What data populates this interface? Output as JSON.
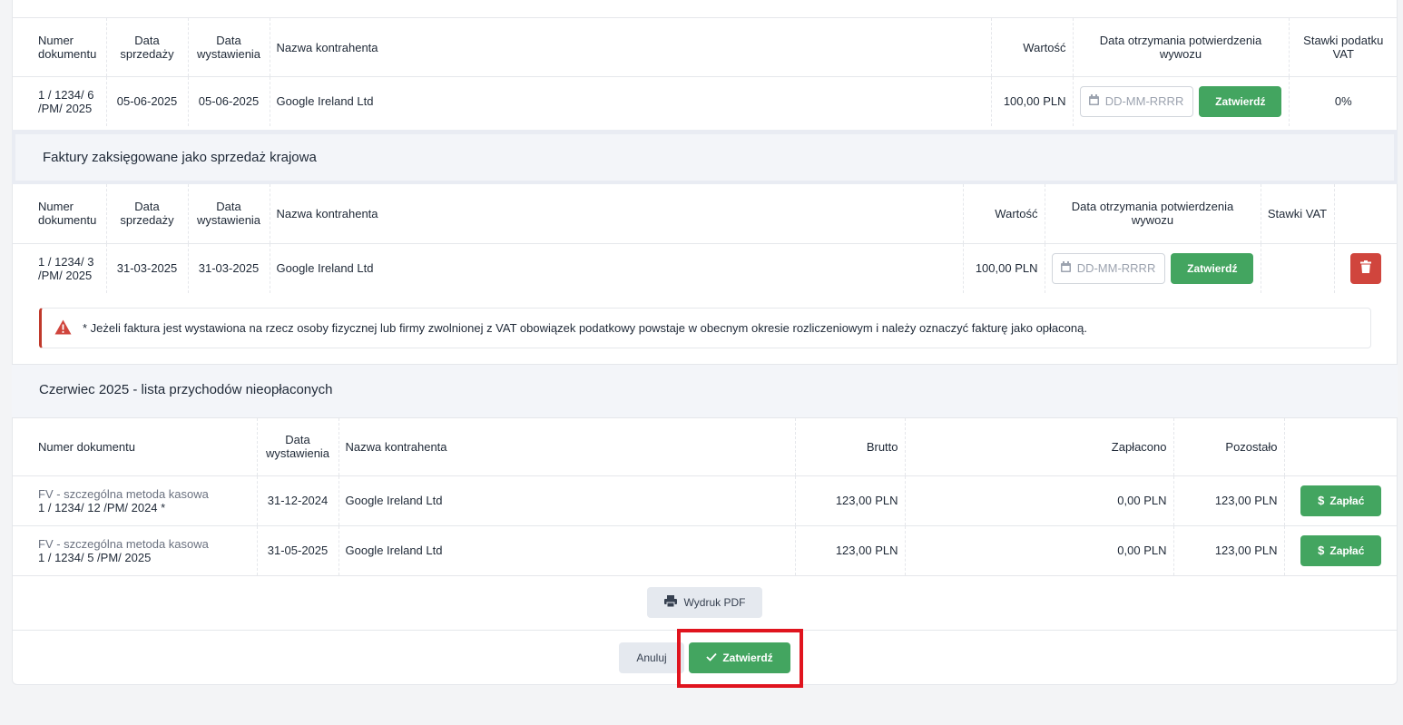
{
  "table1": {
    "headers": [
      "Numer dokumentu",
      "Data sprzedaży",
      "Data wystawienia",
      "Nazwa kontrahenta",
      "Wartość",
      "Data otrzymania potwierdzenia wywozu",
      "Stawki podatku VAT"
    ],
    "row": {
      "number": "1 / 1234/ 6 /PM/ 2025",
      "sale_date": "05-06-2025",
      "issue_date": "05-06-2025",
      "contractor": "Google Ireland Ltd",
      "value": "100,00 PLN",
      "date_placeholder": "DD-MM-RRRR",
      "confirm_label": "Zatwierdź",
      "vat": "0%"
    }
  },
  "section_domestic": {
    "title": "Faktury zaksięgowane jako sprzedaż krajowa"
  },
  "table2": {
    "headers": [
      "Numer dokumentu",
      "Data sprzedaży",
      "Data wystawienia",
      "Nazwa kontrahenta",
      "Wartość",
      "Data otrzymania potwierdzenia wywozu",
      "Stawki VAT"
    ],
    "row": {
      "number": "1 / 1234/ 3 /PM/ 2025",
      "sale_date": "31-03-2025",
      "issue_date": "31-03-2025",
      "contractor": "Google Ireland Ltd",
      "value": "100,00 PLN",
      "date_placeholder": "DD-MM-RRRR",
      "confirm_label": "Zatwierdź",
      "vat": ""
    }
  },
  "alert": {
    "text": "* Jeżeli faktura jest wystawiona na rzecz osoby fizycznej lub firmy zwolnionej z VAT obowiązek podatkowy powstaje w obecnym okresie rozliczeniowym i należy oznaczyć fakturę jako opłaconą."
  },
  "section_unpaid": {
    "title": "Czerwiec 2025 - lista przychodów nieopłaconych"
  },
  "table3": {
    "headers": [
      "Numer dokumentu",
      "Data wystawienia",
      "Nazwa kontrahenta",
      "Brutto",
      "Zapłacono",
      "Pozostało"
    ],
    "rows": [
      {
        "type": "FV - szczególna metoda kasowa",
        "number": "1 / 1234/ 12 /PM/ 2024 *",
        "issue_date": "31-12-2024",
        "contractor": "Google Ireland Ltd",
        "gross": "123,00 PLN",
        "paid": "0,00 PLN",
        "remaining": "123,00 PLN",
        "pay_label": "Zapłać"
      },
      {
        "type": "FV - szczególna metoda kasowa",
        "number": "1 / 1234/ 5 /PM/ 2025",
        "issue_date": "31-05-2025",
        "contractor": "Google Ireland Ltd",
        "gross": "123,00 PLN",
        "paid": "0,00 PLN",
        "remaining": "123,00 PLN",
        "pay_label": "Zapłać"
      }
    ]
  },
  "footer": {
    "pdf_label": "Wydruk PDF",
    "cancel_label": "Anuluj",
    "confirm_label": "Zatwierdź"
  },
  "colors": {
    "green": "#43a560",
    "red": "#d0453d",
    "highlight": "#e0141e"
  },
  "icons": {
    "calendar": "calendar-icon",
    "trash": "trash-icon",
    "warning": "warning-icon",
    "dollar": "dollar-icon",
    "printer": "printer-icon",
    "check": "check-icon"
  }
}
